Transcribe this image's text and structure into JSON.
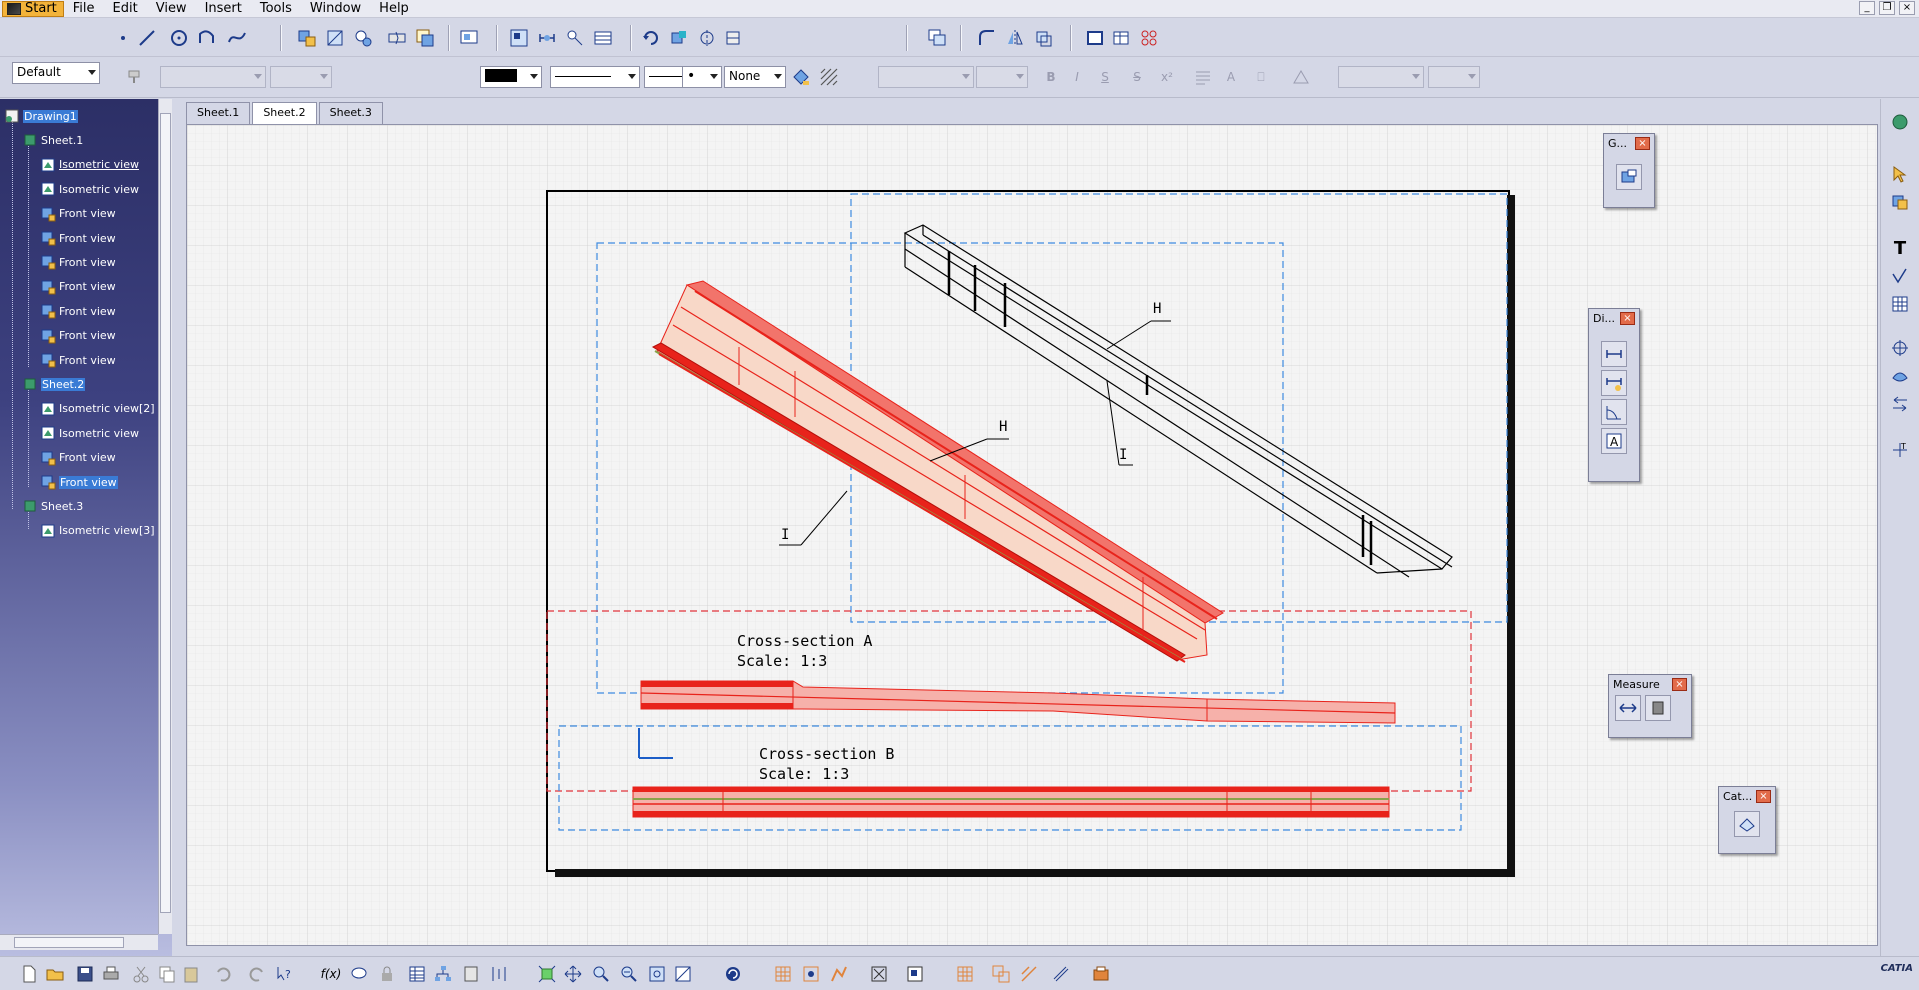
{
  "menu": {
    "start": "Start",
    "items": [
      "File",
      "Edit",
      "View",
      "Insert",
      "Tools",
      "Window",
      "Help"
    ]
  },
  "toolbar": {
    "style_combo": "Default",
    "line_none": "None"
  },
  "tree": {
    "nodes": [
      {
        "label": "Drawing1",
        "selected": true
      },
      {
        "label": "Sheet.1"
      },
      {
        "label": "Isometric view",
        "underline": true
      },
      {
        "label": "Isometric view"
      },
      {
        "label": "Front view"
      },
      {
        "label": "Front view"
      },
      {
        "label": "Front view"
      },
      {
        "label": "Front view"
      },
      {
        "label": "Front view"
      },
      {
        "label": "Front view"
      },
      {
        "label": "Front view"
      },
      {
        "label": "Sheet.2",
        "selected": true
      },
      {
        "label": "Isometric view[2]"
      },
      {
        "label": "Isometric view"
      },
      {
        "label": "Front view"
      },
      {
        "label": "Front view",
        "selected": true
      },
      {
        "label": "Sheet.3"
      },
      {
        "label": "Isometric view[3]"
      }
    ]
  },
  "tabs": [
    "Sheet.1",
    "Sheet.2",
    "Sheet.3"
  ],
  "drawing": {
    "label_h1": "H",
    "label_i1": "I",
    "label_h2": "H",
    "label_i2": "I",
    "section_a_title": "Cross-section A",
    "section_a_scale": "Scale:  1:3",
    "section_b_title": "Cross-section B",
    "section_b_scale": "Scale:  1:3"
  },
  "palettes": {
    "geometry": "G...",
    "dimension": "Di...",
    "measure": "Measure",
    "catalog": "Cat..."
  },
  "brand": "CATIA",
  "colors": {
    "accent_red": "#e8231b",
    "dashed_blue": "#3d8be0",
    "dashed_red": "#e0333a",
    "tree_select": "#3a7bd5"
  }
}
